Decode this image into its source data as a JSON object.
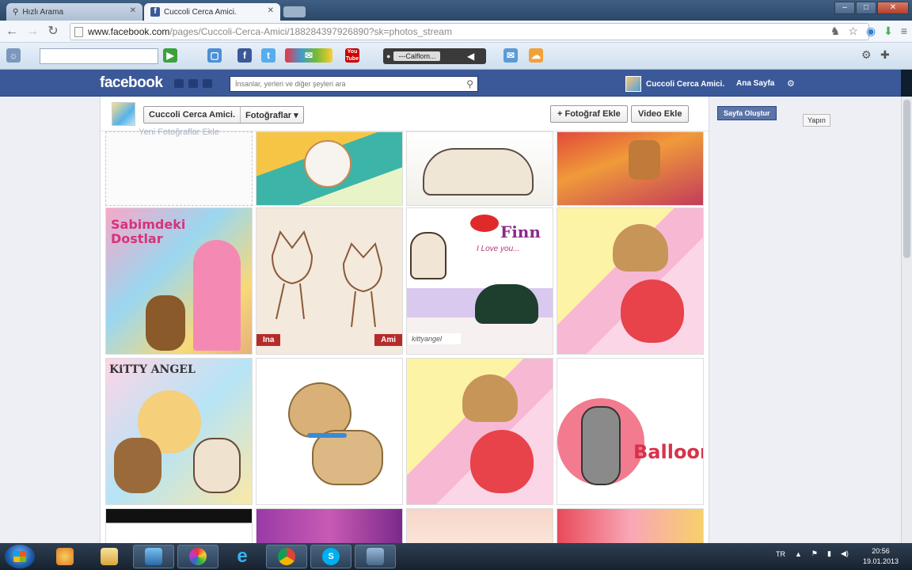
{
  "browser": {
    "tabs": [
      {
        "label": "Hızlı Arama",
        "active": false
      },
      {
        "label": "Cuccoli Cerca Amici.",
        "active": true
      }
    ],
    "url_host": "www.facebook.com",
    "url_path": "/pages/Cuccoli-Cerca-Amici/188284397926890?sk=photos_stream",
    "toolbar_radio_station": "---Calflom...",
    "toolbar_youtube_label": "You Tube"
  },
  "facebook": {
    "logo": "facebook",
    "search_placeholder": "İnsanlar, yerleri ve diğer şeyleri ara",
    "user_name": "Cuccoli Cerca Amici.",
    "home_label": "Ana Sayfa",
    "create_page_button": "Sayfa Oluştur",
    "tooltip_text": "Yapın"
  },
  "page": {
    "breadcrumb_name": "Cuccoli Cerca Amici.",
    "breadcrumb_section": "Fotoğraflar ▾",
    "add_photo_button": "+ Fotoğraf Ekle",
    "add_video_button": "Video Ekle",
    "empty_tile_label": "Yeni Fotoğraflar Ekle"
  },
  "photos": {
    "row2": {
      "dostlar_title": "Sabimdeki Dostlar",
      "cat_caption_left": "Ina",
      "cat_caption_right": "Ami",
      "finn_title": "Finn",
      "finn_subtitle": "I Love you...",
      "finn_footer": "kittyangel"
    },
    "row3": {
      "kitty_title": "KiTTY ANGEL",
      "balloon_title": "Balloon"
    }
  },
  "taskbar": {
    "language": "TR",
    "time": "20:56",
    "date": "19.01.2013"
  }
}
